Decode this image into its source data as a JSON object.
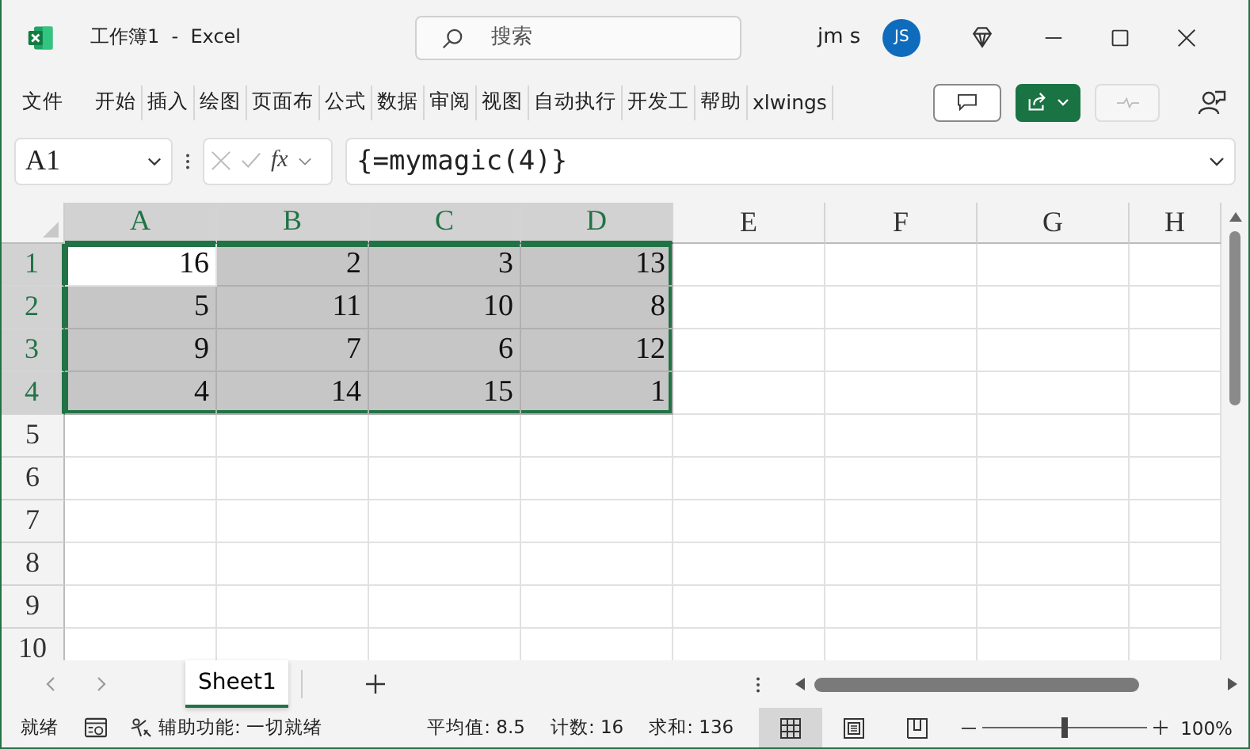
{
  "window": {
    "title": "工作簿1  -  Excel"
  },
  "search": {
    "placeholder": "搜索"
  },
  "user": {
    "name": "jm s",
    "initials": "JS"
  },
  "ribbon_tabs": [
    "文件",
    "开始",
    "插入",
    "绘图",
    "页面布",
    "公式",
    "数据",
    "审阅",
    "视图",
    "自动执行",
    "开发工",
    "帮助",
    "xlwings"
  ],
  "formula_bar": {
    "name_box": "A1",
    "fx": "fx",
    "formula": "{=mymagic(4)}"
  },
  "columns": [
    {
      "label": "A",
      "selected": true
    },
    {
      "label": "B",
      "selected": true
    },
    {
      "label": "C",
      "selected": true
    },
    {
      "label": "D",
      "selected": true
    },
    {
      "label": "E",
      "selected": false
    },
    {
      "label": "F",
      "selected": false
    },
    {
      "label": "G",
      "selected": false
    },
    {
      "label": "H",
      "selected": false
    }
  ],
  "rows": [
    {
      "label": "1",
      "selected": true,
      "cells": [
        {
          "text": "16",
          "active": true
        },
        {
          "text": "2",
          "active": false
        },
        {
          "text": "3",
          "active": false
        },
        {
          "text": "13",
          "active": false
        }
      ]
    },
    {
      "label": "2",
      "selected": true,
      "cells": [
        {
          "text": "5",
          "active": false
        },
        {
          "text": "11",
          "active": false
        },
        {
          "text": "10",
          "active": false
        },
        {
          "text": "8",
          "active": false
        }
      ]
    },
    {
      "label": "3",
      "selected": true,
      "cells": [
        {
          "text": "9",
          "active": false
        },
        {
          "text": "7",
          "active": false
        },
        {
          "text": "6",
          "active": false
        },
        {
          "text": "12",
          "active": false
        }
      ]
    },
    {
      "label": "4",
      "selected": true,
      "cells": [
        {
          "text": "4",
          "active": false
        },
        {
          "text": "14",
          "active": false
        },
        {
          "text": "15",
          "active": false
        },
        {
          "text": "1",
          "active": false
        }
      ]
    },
    {
      "label": "5",
      "selected": false,
      "cells": []
    },
    {
      "label": "6",
      "selected": false,
      "cells": []
    },
    {
      "label": "7",
      "selected": false,
      "cells": []
    },
    {
      "label": "8",
      "selected": false,
      "cells": []
    },
    {
      "label": "9",
      "selected": false,
      "cells": []
    },
    {
      "label": "10",
      "selected": false,
      "cells": []
    }
  ],
  "sheet_tabs": [
    {
      "label": "Sheet1",
      "selected": true
    }
  ],
  "status_bar": {
    "mode": "就绪",
    "accessibility": "辅助功能: 一切就绪",
    "stats": [
      "平均值: 8.5",
      "计数: 16",
      "求和: 136"
    ],
    "views": [
      {
        "kind": "normal",
        "selected": true
      },
      {
        "kind": "page_layout",
        "selected": false
      },
      {
        "kind": "page_break",
        "selected": false
      }
    ],
    "zoom": {
      "level": 0.5,
      "reading": "100%"
    }
  }
}
